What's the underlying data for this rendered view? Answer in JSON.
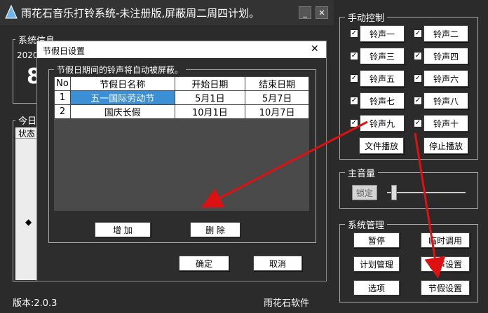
{
  "app": {
    "title": "雨花石音乐打铃系统-未注册版,屏蔽周二周四计划。",
    "version": "版本:2.0.3",
    "company": "雨花石软件",
    "sys_info_label": "系统信息",
    "sys_info_year": "2020",
    "today_label": "今日",
    "status_col": "状态",
    "big_digit": "8"
  },
  "manual": {
    "label": "手动控制",
    "bells": [
      "铃声一",
      "铃声二",
      "铃声三",
      "铃声四",
      "铃声五",
      "铃声六",
      "铃声七",
      "铃声八",
      "铃声九",
      "铃声十"
    ],
    "file_play": "文件播放",
    "stop_play": "停止播放"
  },
  "volume": {
    "label": "主音量",
    "lock": "锁定"
  },
  "sysmgmt": {
    "label": "系统管理",
    "buttons": [
      "暂停",
      "临时调用",
      "计划管理",
      "铃声设置",
      "选项",
      "节假设置"
    ]
  },
  "dialog": {
    "title": "节假日设置",
    "group_label": "节假日期间的铃声将自动被屏蔽。",
    "headers": [
      "No",
      "节假日名称",
      "开始日期",
      "结束日期"
    ],
    "rows": [
      {
        "no": "1",
        "name": "五一国际劳动节",
        "start": "5月1日",
        "end": "5月7日"
      },
      {
        "no": "2",
        "name": "国庆长假",
        "start": "10月1日",
        "end": "10月7日"
      }
    ],
    "add": "增 加",
    "delete": "删 除",
    "ok": "确定",
    "cancel": "取消",
    "close": "✕"
  },
  "colors": {
    "arrow": "#d11",
    "selection": "#3b8fd4",
    "bg": "#2b2b2b"
  }
}
